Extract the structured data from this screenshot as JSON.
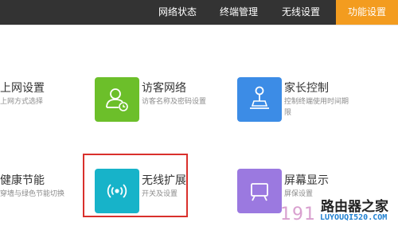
{
  "nav": {
    "items": [
      {
        "label": "网络状态"
      },
      {
        "label": "终端管理"
      },
      {
        "label": "无线设置"
      },
      {
        "label": "功能设置",
        "active": true
      }
    ]
  },
  "features": [
    {
      "title": "上网设置",
      "desc": "上网方式选择"
    },
    {
      "title": "访客网络",
      "desc": "访客名称及密码设置"
    },
    {
      "title": "家长控制",
      "desc": "控制终端使用时间期限"
    },
    {
      "title": "健康节能",
      "desc": "穿墙与绿色节能切换"
    },
    {
      "title": "无线扩展",
      "desc": "开关及设置"
    },
    {
      "title": "屏幕显示",
      "desc": "屏保设置"
    }
  ],
  "colors": {
    "nav_bg": "#333333",
    "active": "#f39c1f",
    "guest_tile": "#6cbf2a",
    "parental_tile": "#3c8ce6",
    "extend_tile": "#17b3c9",
    "screen_tile": "#9b79e0",
    "highlight": "#d9302c"
  },
  "watermark": {
    "site": "路由器之家",
    "url": "LUYOUQI520.COM",
    "num": "191"
  }
}
